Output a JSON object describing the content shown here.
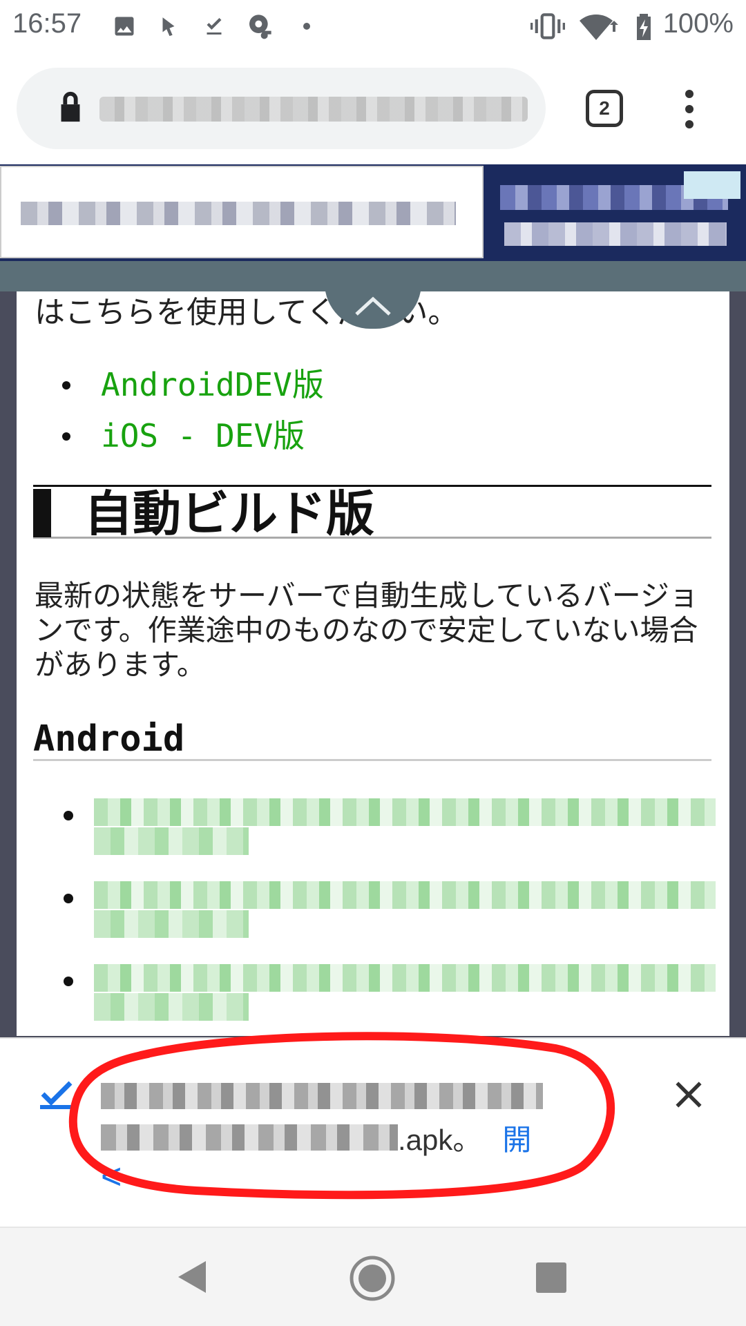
{
  "status_bar": {
    "time": "16:57",
    "battery": "100%",
    "icons": [
      "image-icon",
      "music-app-icon",
      "download-done-icon",
      "vpn-key-icon",
      "dot-icon",
      "vibrate-icon",
      "wifi-icon",
      "battery-charging-icon"
    ]
  },
  "browser": {
    "tab_count": "2",
    "icons": [
      "lock-icon",
      "more-vert-icon"
    ]
  },
  "page": {
    "top_paragraph": "はこちらを使用してください。",
    "dev_links": [
      "AndroidDEV版",
      "iOS - DEV版"
    ],
    "section_title": "自動ビルド版",
    "section_body": "最新の状態をサーバーで自動生成しているバージョンです。作業途中のものなので安定していない場合があります。",
    "android_heading": "Android"
  },
  "snackbar": {
    "file_suffix": ".apk。",
    "open_label": "開",
    "back_label": "<",
    "icons": [
      "check-icon",
      "close-icon"
    ]
  },
  "colors": {
    "link_green": "#18a20f",
    "accent_blue": "#1a73e8",
    "highlight_red": "#ff1a1a",
    "ad_navy": "#1b2a5e",
    "ad_strip": "#5b6f78"
  }
}
